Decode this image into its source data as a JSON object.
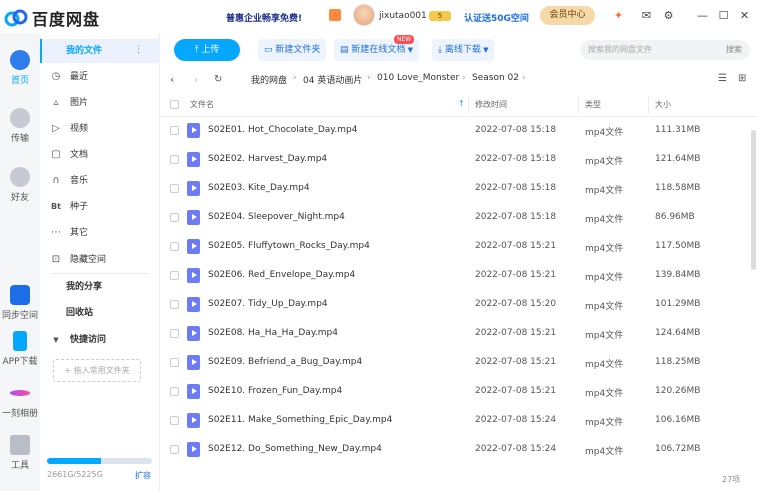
{
  "app": {
    "title": "百度网盘"
  },
  "topbar": {
    "promo": "普惠企业畅享免费!",
    "username": "jixutao001",
    "vip_label": "5",
    "promo2": "认证送50G空间",
    "member_btn": "会员中心"
  },
  "sidebar": {
    "items": [
      {
        "label": "首页",
        "icon": "home-icon"
      },
      {
        "label": "传输",
        "icon": "transfer-icon"
      },
      {
        "label": "好友",
        "icon": "friends-icon"
      },
      {
        "label": "同步空间",
        "icon": "sync-icon"
      },
      {
        "label": "APP下载",
        "icon": "phone-icon"
      },
      {
        "label": "一刻相册",
        "icon": "album-icon"
      },
      {
        "label": "工具",
        "icon": "tools-icon"
      }
    ]
  },
  "nav": {
    "my_files": "我的文件",
    "items": [
      {
        "label": "最近",
        "icon": "clock-icon"
      },
      {
        "label": "图片",
        "icon": "image-icon"
      },
      {
        "label": "视频",
        "icon": "video-icon"
      },
      {
        "label": "文档",
        "icon": "doc-icon"
      },
      {
        "label": "音乐",
        "icon": "music-icon"
      },
      {
        "label": "种子",
        "icon": "bt-icon"
      },
      {
        "label": "其它",
        "icon": "more-icon"
      },
      {
        "label": "隐藏空间",
        "icon": "lock-icon"
      }
    ],
    "my_share": "我的分享",
    "recycle": "回收站",
    "quick_access": "快捷访问",
    "add_fav": "+ 拖入常用文件夹",
    "storage_text": "2661G/5225G",
    "storage_fraction": 0.51,
    "expand": "扩容"
  },
  "toolbar": {
    "upload": "上传",
    "new_folder": "新建文件夹",
    "new_online_doc": "新建在线文档",
    "new_badge": "NEW",
    "offline_download": "离线下载",
    "search_placeholder": "搜索我的网盘文件",
    "search_btn": "搜索"
  },
  "breadcrumb": [
    "我的网盘",
    "04 英语动画片",
    "010 Love_Monster",
    "Season 02"
  ],
  "table": {
    "headers": {
      "name": "文件名",
      "time": "修改时间",
      "type": "类型",
      "size": "大小"
    },
    "rows": [
      {
        "name": "S02E01. Hot_Chocolate_Day.mp4",
        "time": "2022-07-08 15:18",
        "type": "mp4文件",
        "size": "111.31MB"
      },
      {
        "name": "S02E02. Harvest_Day.mp4",
        "time": "2022-07-08 15:18",
        "type": "mp4文件",
        "size": "121.64MB"
      },
      {
        "name": "S02E03. Kite_Day.mp4",
        "time": "2022-07-08 15:18",
        "type": "mp4文件",
        "size": "118.58MB"
      },
      {
        "name": "S02E04. Sleepover_Night.mp4",
        "time": "2022-07-08 15:18",
        "type": "mp4文件",
        "size": "86.96MB"
      },
      {
        "name": "S02E05. Fluffytown_Rocks_Day.mp4",
        "time": "2022-07-08 15:21",
        "type": "mp4文件",
        "size": "117.50MB"
      },
      {
        "name": "S02E06. Red_Envelope_Day.mp4",
        "time": "2022-07-08 15:21",
        "type": "mp4文件",
        "size": "139.84MB"
      },
      {
        "name": "S02E07. Tidy_Up_Day.mp4",
        "time": "2022-07-08 15:20",
        "type": "mp4文件",
        "size": "101.29MB"
      },
      {
        "name": "S02E08. Ha_Ha_Ha_Day.mp4",
        "time": "2022-07-08 15:21",
        "type": "mp4文件",
        "size": "124.64MB"
      },
      {
        "name": "S02E09. Befriend_a_Bug_Day.mp4",
        "time": "2022-07-08 15:21",
        "type": "mp4文件",
        "size": "118.25MB"
      },
      {
        "name": "S02E10. Frozen_Fun_Day.mp4",
        "time": "2022-07-08 15:21",
        "type": "mp4文件",
        "size": "120.26MB"
      },
      {
        "name": "S02E11. Make_Something_Epic_Day.mp4",
        "time": "2022-07-08 15:24",
        "type": "mp4文件",
        "size": "106.16MB"
      },
      {
        "name": "S02E12. Do_Something_New_Day.mp4",
        "time": "2022-07-08 15:24",
        "type": "mp4文件",
        "size": "106.72MB"
      }
    ],
    "count": "27项"
  }
}
